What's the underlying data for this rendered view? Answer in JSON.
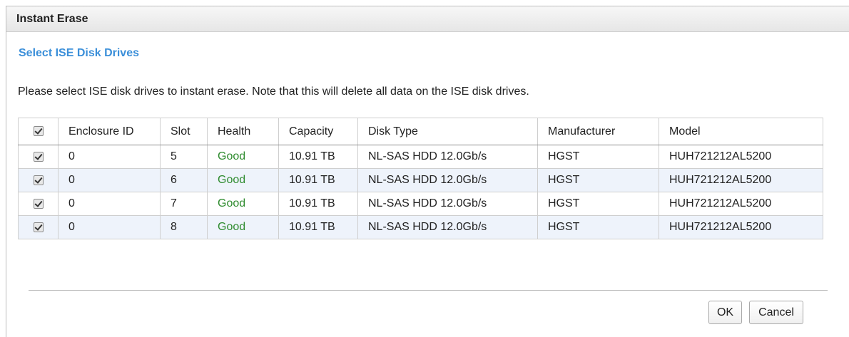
{
  "dialog": {
    "title": "Instant Erase",
    "section_title": "Select ISE Disk Drives",
    "description": "Please select ISE disk drives to instant erase. Note that this will delete all data on the ISE disk drives."
  },
  "table": {
    "select_all_checked": true,
    "columns": [
      "Enclosure ID",
      "Slot",
      "Health",
      "Capacity",
      "Disk Type",
      "Manufacturer",
      "Model"
    ],
    "rows": [
      {
        "checked": true,
        "enclosure_id": "0",
        "slot": "5",
        "health": "Good",
        "capacity": "10.91 TB",
        "disk_type": "NL-SAS HDD 12.0Gb/s",
        "manufacturer": "HGST",
        "model": "HUH721212AL5200"
      },
      {
        "checked": true,
        "enclosure_id": "0",
        "slot": "6",
        "health": "Good",
        "capacity": "10.91 TB",
        "disk_type": "NL-SAS HDD 12.0Gb/s",
        "manufacturer": "HGST",
        "model": "HUH721212AL5200"
      },
      {
        "checked": true,
        "enclosure_id": "0",
        "slot": "7",
        "health": "Good",
        "capacity": "10.91 TB",
        "disk_type": "NL-SAS HDD 12.0Gb/s",
        "manufacturer": "HGST",
        "model": "HUH721212AL5200"
      },
      {
        "checked": true,
        "enclosure_id": "0",
        "slot": "8",
        "health": "Good",
        "capacity": "10.91 TB",
        "disk_type": "NL-SAS HDD 12.0Gb/s",
        "manufacturer": "HGST",
        "model": "HUH721212AL5200"
      }
    ]
  },
  "buttons": {
    "ok_label": "OK",
    "cancel_label": "Cancel"
  },
  "colors": {
    "section_title": "#3b8fd9",
    "health_good": "#2e8b2e",
    "row_alt": "#eef3fb"
  }
}
